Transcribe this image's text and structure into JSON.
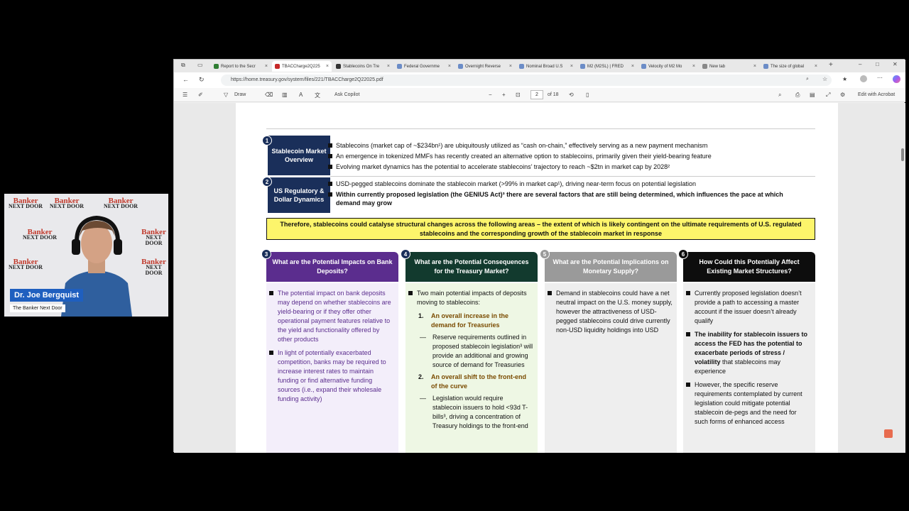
{
  "webcam": {
    "name": "Dr. Joe Bergquist",
    "subtitle": "The Banker Next Door",
    "logo_line1": "Banker",
    "logo_line2": "NEXT DOOR"
  },
  "tabs": [
    {
      "label": "Report to the Secr",
      "color": "#2e7d32"
    },
    {
      "label": "TBACCharge2Q225",
      "color": "#c62828",
      "active": true
    },
    {
      "label": "Stablecoins On Tre",
      "color": "#333333"
    },
    {
      "label": "Federal Governme",
      "color": "#6b8cc7"
    },
    {
      "label": "Overnight Reverse",
      "color": "#6b8cc7"
    },
    {
      "label": "Nominal Broad U.S",
      "color": "#6b8cc7"
    },
    {
      "label": "M2 (M2SL) | FRED",
      "color": "#6b8cc7"
    },
    {
      "label": "Velocity of M2 Mo",
      "color": "#6b8cc7"
    },
    {
      "label": "New tab",
      "color": "#888888"
    },
    {
      "label": "The size of global",
      "color": "#6b8cc7"
    }
  ],
  "address": {
    "url": "https://home.treasury.gov/system/files/221/TBACCharge2Q22025.pdf"
  },
  "pdf_toolbar": {
    "draw": "Draw",
    "ask_copilot": "Ask Copilot",
    "page": "2",
    "of_pages": "of 18",
    "edit_acrobat": "Edit with Acrobat"
  },
  "slide": {
    "sections": [
      {
        "num": "1",
        "title": "Stablecoin Market Overview",
        "bullets": [
          {
            "text": "Stablecoins (market cap of ~$234bn¹) are ubiquitously utilized as “cash on-chain,” effectively serving as a new payment mechanism",
            "bold": false
          },
          {
            "text": "An emergence in tokenized MMFs has recently created an alternative option to stablecoins, primarily given their yield-bearing feature",
            "bold": false
          },
          {
            "text": "Evolving market dynamics has the potential to accelerate stablecoins’ trajectory to reach ~$2tn in market cap by 2028²",
            "bold": false
          }
        ]
      },
      {
        "num": "2",
        "title": "US Regulatory & Dollar Dynamics",
        "bullets": [
          {
            "text": "USD-pegged stablecoins dominate the stablecoin market (>99% in market cap¹), driving near-term focus on potential legislation",
            "bold": false
          },
          {
            "text": "Within currently proposed legislation (the GENIUS Act)³ there are several factors that are still being determined, which influences the pace at which demand may grow",
            "bold": true
          }
        ]
      }
    ],
    "banner": "Therefore, stablecoins could catalyse structural changes across the following areas – the extent of which is likely contingent on the ultimate requirements of U.S. regulated stablecoins and the corresponding growth of the stablecoin market in response",
    "columns": [
      {
        "num": "3",
        "title": "What are the Potential Impacts on Bank Deposits?",
        "head_color": "#5b2d8e",
        "body_color": "#f3eefa",
        "b1": "The potential impact on bank deposits may depend on whether stablecoins are yield-bearing or if they offer other operational payment features relative to the yield and functionality offered by other products",
        "b2": "In light of potentially exacerbated competition, banks may be required to increase interest rates to maintain funding or find alternative funding sources (i.e., expand their wholesale funding activity)"
      },
      {
        "num": "4",
        "title": "What are the Potential Consequences for the Treasury Market?",
        "head_color": "#123a2e",
        "body_color": "#eef7e4",
        "intro": "Two main potential impacts of deposits moving to stablecoins:",
        "n1": "1.",
        "n1_text": "An overall increase in the demand for Treasuries",
        "d1": "Reserve requirements outlined in proposed stablecoin legislation³ will provide an additional and growing source of demand for Treasuries",
        "n2": "2.",
        "n2_text": "An overall shift to the front-end of the curve",
        "d2": "Legislation would require stablecoin issuers to hold <93d T-bills³, driving a concentration of Treasury holdings to the front-end"
      },
      {
        "num": "5",
        "title": "What are the Potential Implications on Monetary Supply?",
        "head_color": "#9a9a9a",
        "body_color": "#eeeeee",
        "b1": "Demand in stablecoins could have a net neutral impact on the U.S. money supply, however the attractiveness of USD-pegged stablecoins could drive currently non-USD liquidity holdings into USD"
      },
      {
        "num": "6",
        "title": "How Could this Potentially Affect Existing Market Structures?",
        "head_color": "#0d0d0d",
        "body_color": "#eeeeee",
        "b1": "Currently proposed legislation doesn’t provide a path to accessing a master account if the issuer doesn’t already qualify",
        "b2_bold": "The inability for stablecoin issuers to access the FED has the potential to exacerbate periods of stress / volatility",
        "b2_rest": " that stablecoins may experience",
        "b3": "However, the specific reserve requirements contemplated by current legislation could mitigate potential stablecoin de-pegs and the need for such forms of enhanced access"
      }
    ]
  }
}
